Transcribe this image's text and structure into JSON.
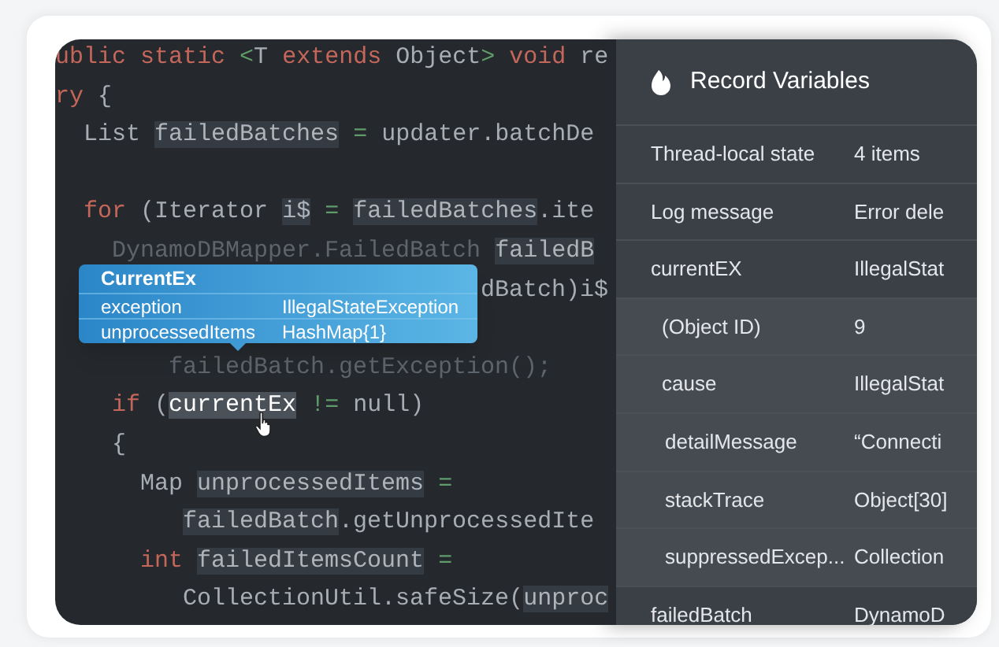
{
  "code_lines": [
    {
      "tokens": [
        {
          "text": "ublic static ",
          "kind": "keyword"
        },
        {
          "text": "<",
          "kind": "operator"
        },
        {
          "text": "T ",
          "kind": "plain"
        },
        {
          "text": "extends",
          "kind": "keyword"
        },
        {
          "text": " Object",
          "kind": "plain"
        },
        {
          "text": ">",
          "kind": "operator"
        },
        {
          "text": " void",
          "kind": "keyword"
        },
        {
          "text": " re",
          "kind": "plain"
        }
      ]
    },
    {
      "tokens": [
        {
          "text": "ry",
          "kind": "keyword"
        },
        {
          "text": " {",
          "kind": "plain"
        }
      ]
    },
    {
      "tokens": [
        {
          "text": "  List ",
          "kind": "plain"
        },
        {
          "text": "failedBatches",
          "kind": "variable"
        },
        {
          "text": " = ",
          "kind": "operator"
        },
        {
          "text": "updater.batchDe",
          "kind": "plain"
        }
      ]
    },
    {
      "blank_line_before": true,
      "tokens": [
        {
          "text": "  for",
          "kind": "keyword"
        },
        {
          "text": " (Iterator ",
          "kind": "plain"
        },
        {
          "text": "i$",
          "kind": "variable"
        },
        {
          "text": " = ",
          "kind": "operator"
        },
        {
          "text": "failedBatches",
          "kind": "variable"
        },
        {
          "text": ".ite",
          "kind": "plain"
        }
      ]
    },
    {
      "tokens": [
        {
          "text": "    DynamoDBMapper.FailedBatch ",
          "kind": "faded"
        },
        {
          "text": "failedB",
          "kind": "variable"
        }
      ]
    },
    {
      "tokens": [
        {
          "text": "                              dBatch)i$",
          "kind": "plain"
        }
      ]
    },
    {
      "blank_line_before": true,
      "tokens": [
        {
          "text": "        failedBatch.getException();",
          "kind": "faded"
        }
      ]
    },
    {
      "tokens": [
        {
          "text": "    if",
          "kind": "keyword"
        },
        {
          "text": " (",
          "kind": "plain"
        },
        {
          "text": "currentEx",
          "kind": "focus"
        },
        {
          "text": " != ",
          "kind": "operator"
        },
        {
          "text": "null)",
          "kind": "plain"
        }
      ]
    },
    {
      "tokens": [
        {
          "text": "    {",
          "kind": "plain"
        }
      ]
    },
    {
      "tokens": [
        {
          "text": "      Map ",
          "kind": "plain"
        },
        {
          "text": "unprocessedItems",
          "kind": "variable"
        },
        {
          "text": " =",
          "kind": "operator"
        }
      ]
    },
    {
      "tokens": [
        {
          "text": "         failedBatch",
          "kind": "variable"
        },
        {
          "text": ".getUnprocessedIte",
          "kind": "plain"
        }
      ]
    },
    {
      "tokens": [
        {
          "text": "      int ",
          "kind": "keyword"
        },
        {
          "text": "failedItemsCount",
          "kind": "variable"
        },
        {
          "text": " =",
          "kind": "operator"
        }
      ]
    },
    {
      "tokens": [
        {
          "text": "         CollectionUtil.safeSize(",
          "kind": "plain"
        },
        {
          "text": "unproc",
          "kind": "variable"
        }
      ]
    }
  ],
  "popup": {
    "title": "CurrentEx",
    "rows": [
      {
        "name": "exception",
        "value": "IllegalStateException"
      },
      {
        "name": "unprocessedItems",
        "value": "HashMap{1}"
      }
    ]
  },
  "panel": {
    "title": "Record Variables",
    "rows": [
      {
        "name": "Thread-local state",
        "value": "4 items"
      },
      {
        "name": "Log message",
        "value": "Error dele"
      },
      {
        "name": "currentEX",
        "value": "IllegalStat",
        "children": [
          {
            "name": "(Object ID)",
            "value": "9"
          },
          {
            "name": "cause",
            "value": "IllegalStat",
            "children": [
              {
                "name": "detailMessage",
                "value": "“Connecti"
              },
              {
                "name": "stackTrace",
                "value": "Object[30]"
              },
              {
                "name": "suppressedExcep...",
                "value": "Collection"
              }
            ]
          }
        ]
      },
      {
        "name": "failedBatch",
        "value": "DynamoD"
      }
    ]
  }
}
